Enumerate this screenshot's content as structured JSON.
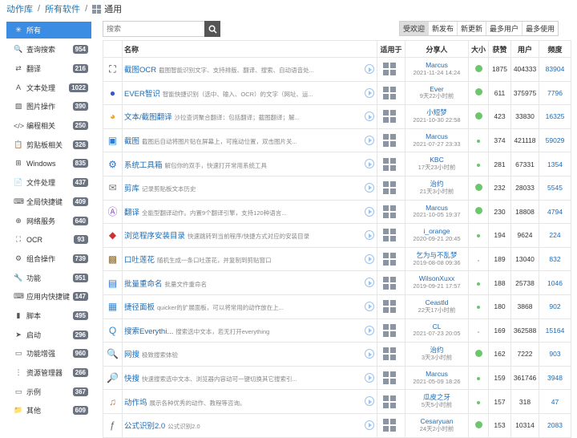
{
  "breadcrumb": {
    "root": "动作库",
    "all": "所有软件",
    "current": "通用"
  },
  "sidebar": [
    {
      "label": "所有",
      "count": "",
      "icon": "✳",
      "active": true
    },
    {
      "label": "查询搜索",
      "count": "954",
      "icon": "🔍"
    },
    {
      "label": "翻译",
      "count": "216",
      "icon": "⇄"
    },
    {
      "label": "文本处理",
      "count": "1022",
      "icon": "A"
    },
    {
      "label": "图片操作",
      "count": "390",
      "icon": "▨"
    },
    {
      "label": "编程相关",
      "count": "250",
      "icon": "</>"
    },
    {
      "label": "剪贴板相关",
      "count": "326",
      "icon": "📋"
    },
    {
      "label": "Windows",
      "count": "835",
      "icon": "⊞"
    },
    {
      "label": "文件处理",
      "count": "437",
      "icon": "📄"
    },
    {
      "label": "全局快捷键",
      "count": "409",
      "icon": "⌨"
    },
    {
      "label": "网络服务",
      "count": "640",
      "icon": "⊕"
    },
    {
      "label": "OCR",
      "count": "93",
      "icon": "⛶"
    },
    {
      "label": "组合操作",
      "count": "739",
      "icon": "⚙"
    },
    {
      "label": "功能",
      "count": "951",
      "icon": "🔧"
    },
    {
      "label": "应用内快捷键",
      "count": "147",
      "icon": "⌨"
    },
    {
      "label": "脚本",
      "count": "495",
      "icon": "▮"
    },
    {
      "label": "启动",
      "count": "296",
      "icon": "➤"
    },
    {
      "label": "功能增强",
      "count": "960",
      "icon": "▭"
    },
    {
      "label": "资源管理器",
      "count": "266",
      "icon": "⋮"
    },
    {
      "label": "示例",
      "count": "367",
      "icon": "▭"
    },
    {
      "label": "其他",
      "count": "609",
      "icon": "📁"
    }
  ],
  "search": {
    "placeholder": "搜索"
  },
  "sort_tabs": [
    {
      "label": "受欢迎",
      "on": true
    },
    {
      "label": "新发布"
    },
    {
      "label": "新更新"
    },
    {
      "label": "最多用户"
    },
    {
      "label": "最多使用"
    }
  ],
  "columns": {
    "name": "名称",
    "fit": "适用于",
    "sharer": "分享人",
    "size": "大小",
    "likes": "获赞",
    "users": "用户",
    "freq": "频度"
  },
  "rows": [
    {
      "icon": "⛶",
      "icolor": "#333",
      "name": "截图OCR",
      "desc": "截图智能识别文字、支持排版、翻译、搜索、自动语音处...",
      "user": "Marcus",
      "time": "2021-11-24 14:24",
      "dot": 9,
      "likes": "1875",
      "users": "404333",
      "freq": "83904"
    },
    {
      "icon": "●",
      "icolor": "#3557c8",
      "name": "EVER智识",
      "desc": "智能快捷识别（选中、输入、OCR）的文字（网址、运...",
      "user": "Ever",
      "time": "9天22小时前",
      "dot": 9,
      "likes": "611",
      "users": "375975",
      "freq": "7796"
    },
    {
      "icon": "◕",
      "icolor": "#f0a020",
      "name": "文本/截图翻译",
      "desc": "沙拉查词聚合翻译：包括翻译；截图翻译；解...",
      "user": "小短梦",
      "time": "2021-10-30 22:58",
      "dot": 9,
      "likes": "423",
      "users": "33830",
      "freq": "16325"
    },
    {
      "icon": "▣",
      "icolor": "#2a7fd4",
      "name": "截图",
      "desc": "截图后自动将图片贴在屏幕上，可拖动位置，双击图片关...",
      "user": "Marcus",
      "time": "2021-07-27 23:33",
      "dot": 4,
      "likes": "374",
      "users": "421118",
      "freq": "59029"
    },
    {
      "icon": "⚙",
      "icolor": "#2a6fd4",
      "name": "系统工具箱",
      "desc": "解包你的双手，快速打开常用系统工具",
      "user": "KBC",
      "time": "17天23小时前",
      "dot": 4,
      "likes": "281",
      "users": "67331",
      "freq": "1354"
    },
    {
      "icon": "✉",
      "icolor": "#777",
      "name": "剪库",
      "desc": "记录剪贴板文本历史",
      "user": "治约",
      "time": "21天3小时前",
      "dot": 9,
      "likes": "232",
      "users": "28033",
      "freq": "5545"
    },
    {
      "icon": "Ⓐ",
      "icolor": "#8a4fd0",
      "name": "翻译",
      "desc": "全能型翻译动作。内置9个翻译引擎，支持120种语言...",
      "user": "Marcus",
      "time": "2021-10-05 19:37",
      "dot": 9,
      "likes": "230",
      "users": "18808",
      "freq": "4794"
    },
    {
      "icon": "◆",
      "icolor": "#d03030",
      "name": "浏览程序安装目录",
      "desc": "快速跳转到当前程序/快捷方式对应的安装目录",
      "user": "i_orange",
      "time": "2020-09-21 20:45",
      "dot": 4,
      "likes": "194",
      "users": "9624",
      "freq": "224"
    },
    {
      "icon": "▩",
      "icolor": "#8a6a30",
      "name": "口吐莲花",
      "desc": "随机生成一条口吐莲花，并复制到剪贴窗口",
      "user": "乞为与不乱梦",
      "time": "2019-08-08 09:36",
      "dot": 2,
      "likes": "189",
      "users": "13040",
      "freq": "832"
    },
    {
      "icon": "▤",
      "icolor": "#2a6fd4",
      "name": "批量重命名",
      "desc": "批量文件重命名",
      "user": "WilsonXuxx",
      "time": "2019-09-21 17:57",
      "dot": 4,
      "likes": "188",
      "users": "25738",
      "freq": "1046"
    },
    {
      "icon": "▦",
      "icolor": "#3a8ad0",
      "name": "捷径面板",
      "desc": "quicker的扩展面板，可以将常用的动作放在上...",
      "user": "Ceastld",
      "time": "22天17小时前",
      "dot": 4,
      "likes": "180",
      "users": "3868",
      "freq": "902"
    },
    {
      "icon": "Q",
      "icolor": "#2a8ad4",
      "name": "搜索Everythi...",
      "desc": "搜索选中文本，若无打开everything",
      "user": "CL",
      "time": "2021-07-23 20:05",
      "dot": 2,
      "likes": "169",
      "users": "362588",
      "freq": "15164"
    },
    {
      "icon": "🔍",
      "icolor": "#555",
      "name": "网搜",
      "desc": "极致搜索体验",
      "user": "治约",
      "time": "3天3小时前",
      "dot": 9,
      "likes": "162",
      "users": "7222",
      "freq": "903"
    },
    {
      "icon": "🔎",
      "icolor": "#2a6fd4",
      "name": "快搜",
      "desc": "快速搜索选中文本、浏览器内容动可一键切换其它搜索引...",
      "user": "Marcus",
      "time": "2021-05-09 18:26",
      "dot": 4,
      "likes": "159",
      "users": "361746",
      "freq": "3948"
    },
    {
      "icon": "♫",
      "icolor": "#c08030",
      "name": "动作坞",
      "desc": "展示各种优秀的动作、教程等咨询。",
      "user": "瓜皮之牙",
      "time": "5天5小时前",
      "dot": 4,
      "likes": "157",
      "users": "318",
      "freq": "47"
    },
    {
      "icon": "ƒ",
      "icolor": "#666",
      "name": "公式识别2.0",
      "desc": "公式识别2.0",
      "user": "Cesaryuan",
      "time": "24天2小时前",
      "dot": 9,
      "likes": "153",
      "users": "10314",
      "freq": "2083"
    }
  ]
}
